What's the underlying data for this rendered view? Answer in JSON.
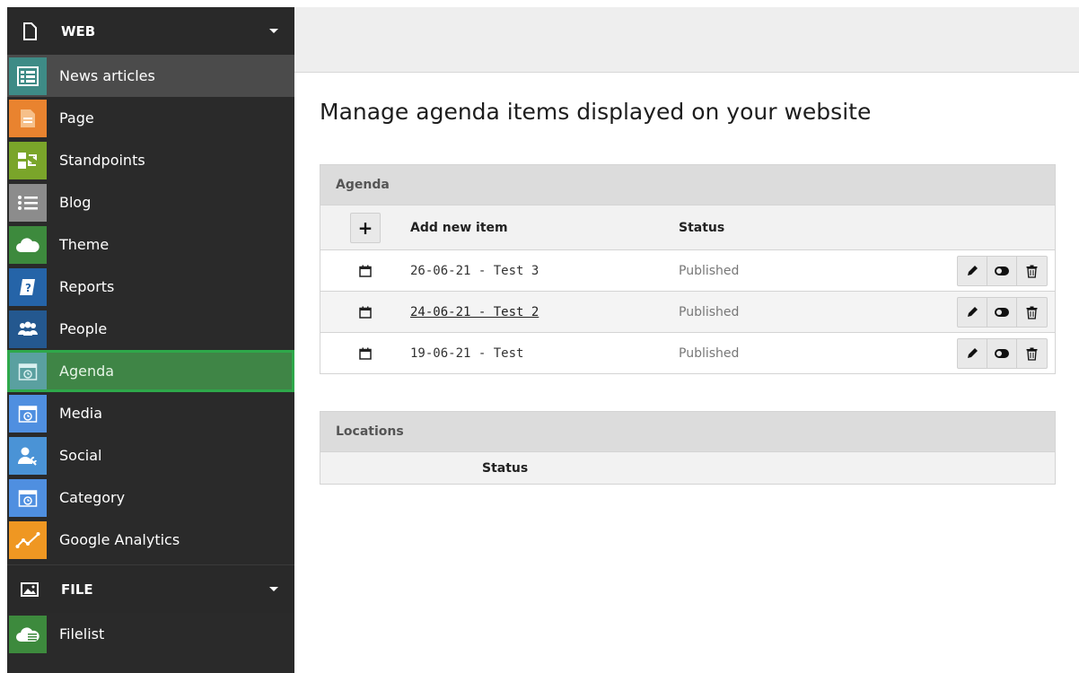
{
  "sidebar": {
    "web_section": {
      "label": "WEB",
      "icon": "document-icon"
    },
    "file_section": {
      "label": "FILE",
      "icon": "image-icon"
    },
    "items": [
      {
        "label": "News articles",
        "icon": "list-table-icon",
        "color": "#3e8b86"
      },
      {
        "label": "Page",
        "icon": "page-icon",
        "color": "#e9832f"
      },
      {
        "label": "Standpoints",
        "icon": "swap-icon",
        "color": "#7aa52a"
      },
      {
        "label": "Blog",
        "icon": "bulleted-list-icon",
        "color": "#8c8c8c"
      },
      {
        "label": "Theme",
        "icon": "cloud-icon",
        "color": "#3d8a3d"
      },
      {
        "label": "Reports",
        "icon": "report-icon",
        "color": "#2564a8"
      },
      {
        "label": "People",
        "icon": "people-icon",
        "color": "#24588f"
      },
      {
        "label": "Agenda",
        "icon": "calendar-clock-icon",
        "color": "#5aa0a0"
      },
      {
        "label": "Media",
        "icon": "calendar-clock-icon",
        "color": "#4f8fe0"
      },
      {
        "label": "Social",
        "icon": "user-wrench-icon",
        "color": "#4a93d6"
      },
      {
        "label": "Category",
        "icon": "calendar-clock-icon",
        "color": "#4f8fe0"
      },
      {
        "label": "Google Analytics",
        "icon": "analytics-line-icon",
        "color": "#ef9722"
      }
    ],
    "file_items": [
      {
        "label": "Filelist",
        "icon": "cloud-list-icon",
        "color": "#3d8a3d"
      }
    ]
  },
  "main": {
    "title": "Manage agenda items displayed on your website",
    "agenda_panel": {
      "heading": "Agenda",
      "add_label": "+",
      "col_title": "Add new item",
      "col_status": "Status",
      "rows": [
        {
          "title": "26-06-21 - Test 3",
          "status": "Published"
        },
        {
          "title": "24-06-21 - Test 2",
          "status": "Published"
        },
        {
          "title": "19-06-21 - Test",
          "status": "Published"
        }
      ]
    },
    "locations_panel": {
      "heading": "Locations",
      "col_status": "Status"
    }
  },
  "colors": {
    "sidebar_bg": "#2a2a2a",
    "selected_item_bg": "#3f8546",
    "selected_outline": "#2ea84a",
    "panel_header_bg": "#dcdcdc"
  }
}
